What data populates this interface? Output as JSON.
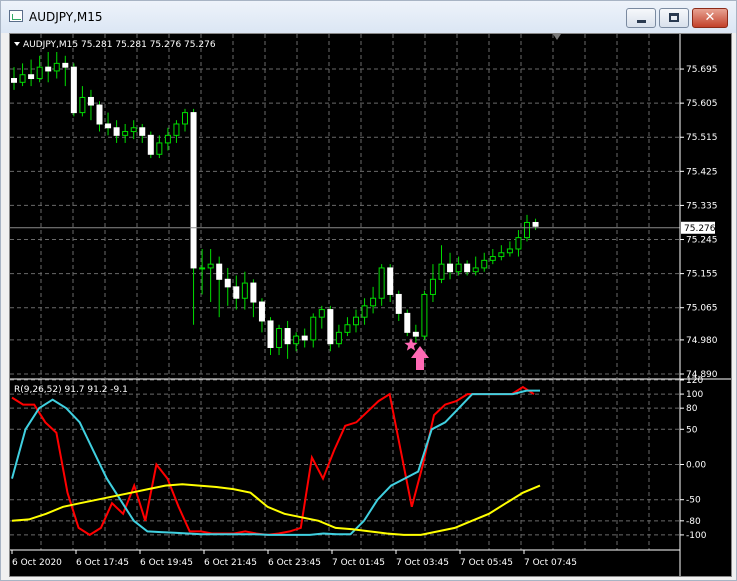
{
  "window": {
    "title": "AUDJPY,M15",
    "minimize_icon": "minimize-icon",
    "maximize_icon": "maximize-icon",
    "close_icon": "close-icon"
  },
  "main_chart": {
    "header": "AUDJPY,M15  75.281 75.281 75.276 75.276",
    "symbol": "AUDJPY",
    "timeframe": "M15",
    "ohlc": {
      "open": 75.281,
      "high": 75.281,
      "low": 75.276,
      "close": 75.276
    },
    "current_price_label": "75.276",
    "price_axis_labels": [
      "75.695",
      "75.605",
      "75.515",
      "75.425",
      "75.335",
      "75.245",
      "75.155",
      "75.065",
      "74.980",
      "74.890"
    ],
    "markers": [
      "pink-star-icon",
      "pink-up-arrow-icon"
    ]
  },
  "chart_data": [
    {
      "type": "candlestick",
      "ylim": [
        74.89,
        75.74
      ],
      "grid": true,
      "current_price": 75.276,
      "candles": [
        [
          75.67,
          75.66,
          75.7,
          75.64
        ],
        [
          75.66,
          75.68,
          75.71,
          75.65
        ],
        [
          75.68,
          75.67,
          75.72,
          75.65
        ],
        [
          75.67,
          75.7,
          75.73,
          75.66
        ],
        [
          75.7,
          75.69,
          75.74,
          75.66
        ],
        [
          75.69,
          75.71,
          75.74,
          75.67
        ],
        [
          75.71,
          75.7,
          75.73,
          75.65
        ],
        [
          75.7,
          75.58,
          75.71,
          75.57
        ],
        [
          75.58,
          75.62,
          75.65,
          75.57
        ],
        [
          75.62,
          75.6,
          75.64,
          75.56
        ],
        [
          75.6,
          75.55,
          75.61,
          75.53
        ],
        [
          75.55,
          75.54,
          75.58,
          75.52
        ],
        [
          75.54,
          75.52,
          75.56,
          75.5
        ],
        [
          75.52,
          75.53,
          75.55,
          75.5
        ],
        [
          75.53,
          75.54,
          75.56,
          75.51
        ],
        [
          75.54,
          75.52,
          75.55,
          75.5
        ],
        [
          75.52,
          75.47,
          75.53,
          75.46
        ],
        [
          75.47,
          75.5,
          75.52,
          75.46
        ],
        [
          75.5,
          75.52,
          75.54,
          75.48
        ],
        [
          75.52,
          75.55,
          75.56,
          75.5
        ],
        [
          75.55,
          75.58,
          75.59,
          75.53
        ],
        [
          75.58,
          75.17,
          75.59,
          75.02
        ],
        [
          75.17,
          75.17,
          75.22,
          75.1
        ],
        [
          75.17,
          75.18,
          75.22,
          75.08
        ],
        [
          75.18,
          75.14,
          75.2,
          75.04
        ],
        [
          75.14,
          75.12,
          75.17,
          75.07
        ],
        [
          75.12,
          75.09,
          75.15,
          75.06
        ],
        [
          75.09,
          75.13,
          75.16,
          75.06
        ],
        [
          75.13,
          75.08,
          75.14,
          75.04
        ],
        [
          75.08,
          75.03,
          75.09,
          75.0
        ],
        [
          75.03,
          74.96,
          75.04,
          74.94
        ],
        [
          74.96,
          75.01,
          75.02,
          74.94
        ],
        [
          75.01,
          74.97,
          75.03,
          74.93
        ],
        [
          74.97,
          74.99,
          75.0,
          74.95
        ],
        [
          74.99,
          74.98,
          75.01,
          74.96
        ],
        [
          74.98,
          75.04,
          75.05,
          74.96
        ],
        [
          75.04,
          75.06,
          75.07,
          75.01
        ],
        [
          75.06,
          74.97,
          75.07,
          74.95
        ],
        [
          74.97,
          75.0,
          75.02,
          74.96
        ],
        [
          75.0,
          75.02,
          75.04,
          74.99
        ],
        [
          75.02,
          75.04,
          75.06,
          75.0
        ],
        [
          75.04,
          75.07,
          75.09,
          75.02
        ],
        [
          75.07,
          75.09,
          75.12,
          75.05
        ],
        [
          75.09,
          75.17,
          75.18,
          75.07
        ],
        [
          75.17,
          75.1,
          75.18,
          75.08
        ],
        [
          75.1,
          75.05,
          75.11,
          75.03
        ],
        [
          75.05,
          75.0,
          75.06,
          74.99
        ],
        [
          75.0,
          74.99,
          75.02,
          74.97
        ],
        [
          74.99,
          75.1,
          75.11,
          74.98
        ],
        [
          75.1,
          75.14,
          75.18,
          75.08
        ],
        [
          75.14,
          75.18,
          75.23,
          75.13
        ],
        [
          75.18,
          75.16,
          75.21,
          75.14
        ],
        [
          75.16,
          75.18,
          75.2,
          75.15
        ],
        [
          75.18,
          75.16,
          75.19,
          75.15
        ],
        [
          75.16,
          75.17,
          75.2,
          75.15
        ],
        [
          75.17,
          75.19,
          75.21,
          75.16
        ],
        [
          75.19,
          75.2,
          75.22,
          75.18
        ],
        [
          75.2,
          75.21,
          75.23,
          75.19
        ],
        [
          75.21,
          75.22,
          75.24,
          75.2
        ],
        [
          75.22,
          75.25,
          75.27,
          75.2
        ],
        [
          75.25,
          75.29,
          75.31,
          75.24
        ],
        [
          75.29,
          75.28,
          75.3,
          75.27
        ]
      ]
    },
    {
      "type": "line",
      "title": "R(9,26,52) 91.7 91.2 -9.1",
      "ylim": [
        -120,
        120
      ],
      "yticks": [
        120,
        100,
        80,
        50,
        0,
        -50,
        -80,
        -100
      ],
      "ytick_labels": [
        "120",
        "100",
        "80",
        "50",
        "0.00",
        "-50",
        "-80",
        "-100"
      ],
      "x": [
        "6 Oct 2020",
        "6 Oct 17:45",
        "6 Oct 19:45",
        "6 Oct 21:45",
        "6 Oct 23:45",
        "7 Oct 01:45",
        "7 Oct 03:45",
        "7 Oct 05:45",
        "7 Oct 07:45"
      ],
      "series": [
        {
          "color": "#ff0000",
          "values": [
            95,
            85,
            85,
            60,
            45,
            -40,
            -90,
            -100,
            -90,
            -55,
            -70,
            -30,
            -80,
            0,
            -20,
            -60,
            -95,
            -95,
            -98,
            -98,
            -98,
            -95,
            -98,
            -100,
            -98,
            -95,
            -90,
            10,
            -20,
            20,
            55,
            60,
            75,
            90,
            100,
            20,
            -60,
            0,
            70,
            85,
            90,
            100,
            100,
            100,
            100,
            100,
            110,
            100
          ]
        },
        {
          "color": "#40d0e0",
          "values": [
            -20,
            50,
            80,
            92,
            80,
            60,
            20,
            -20,
            -50,
            -80,
            -95,
            -96,
            -97,
            -98,
            -99,
            -99,
            -99,
            -99,
            -99,
            -100,
            -100,
            -100,
            -100,
            -98,
            -99,
            -99,
            -80,
            -50,
            -30,
            -20,
            -10,
            50,
            60,
            80,
            100,
            100,
            100,
            100,
            105,
            105
          ]
        },
        {
          "color": "#ffff00",
          "values": [
            -80,
            -78,
            -70,
            -60,
            -55,
            -50,
            -45,
            -40,
            -35,
            -30,
            -28,
            -30,
            -32,
            -35,
            -40,
            -60,
            -70,
            -75,
            -80,
            -90,
            -92,
            -95,
            -98,
            -100,
            -100,
            -95,
            -90,
            -80,
            -70,
            -55,
            -40,
            -30
          ]
        }
      ]
    }
  ]
}
